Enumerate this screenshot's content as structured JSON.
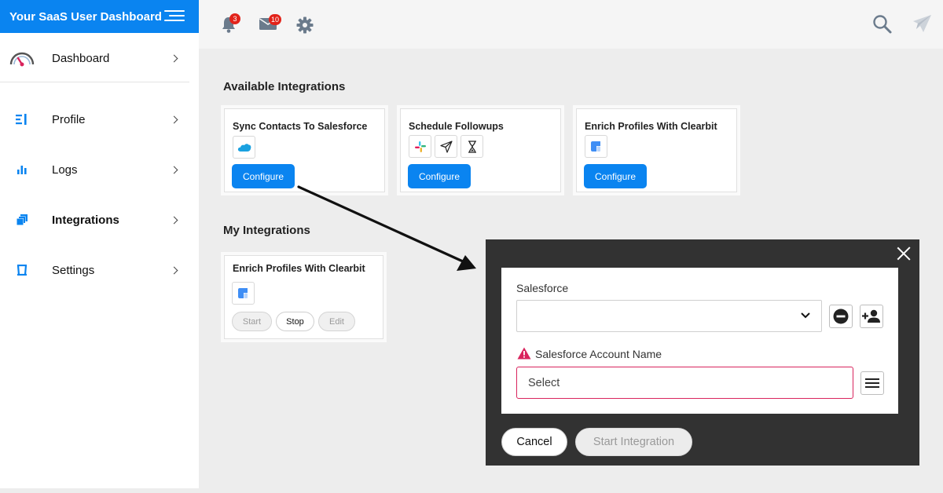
{
  "app": {
    "title": "Your SaaS User Dashboard"
  },
  "sidebar": {
    "items": [
      {
        "label": "Dashboard"
      },
      {
        "label": "Profile"
      },
      {
        "label": "Logs"
      },
      {
        "label": "Integrations"
      },
      {
        "label": "Settings"
      }
    ]
  },
  "topbar": {
    "notifications_count": "3",
    "messages_count": "10"
  },
  "available": {
    "title": "Available Integrations",
    "cards": [
      {
        "title": "Sync Contacts To Salesforce",
        "button": "Configure"
      },
      {
        "title": "Schedule Followups",
        "button": "Configure"
      },
      {
        "title": "Enrich Profiles With Clearbit",
        "button": "Configure"
      }
    ]
  },
  "mine": {
    "title": "My Integrations",
    "card": {
      "title": "Enrich Profiles With Clearbit",
      "start": "Start",
      "stop": "Stop",
      "edit": "Edit"
    }
  },
  "modal": {
    "salesforce_label": "Salesforce",
    "salesforce_value": "",
    "account_label": "Salesforce Account Name",
    "account_placeholder": "Select",
    "cancel": "Cancel",
    "start": "Start Integration"
  },
  "colors": {
    "brand": "#0a84f0",
    "error": "#d9245d",
    "badge": "#e2231a",
    "modal_bg": "#323232"
  }
}
